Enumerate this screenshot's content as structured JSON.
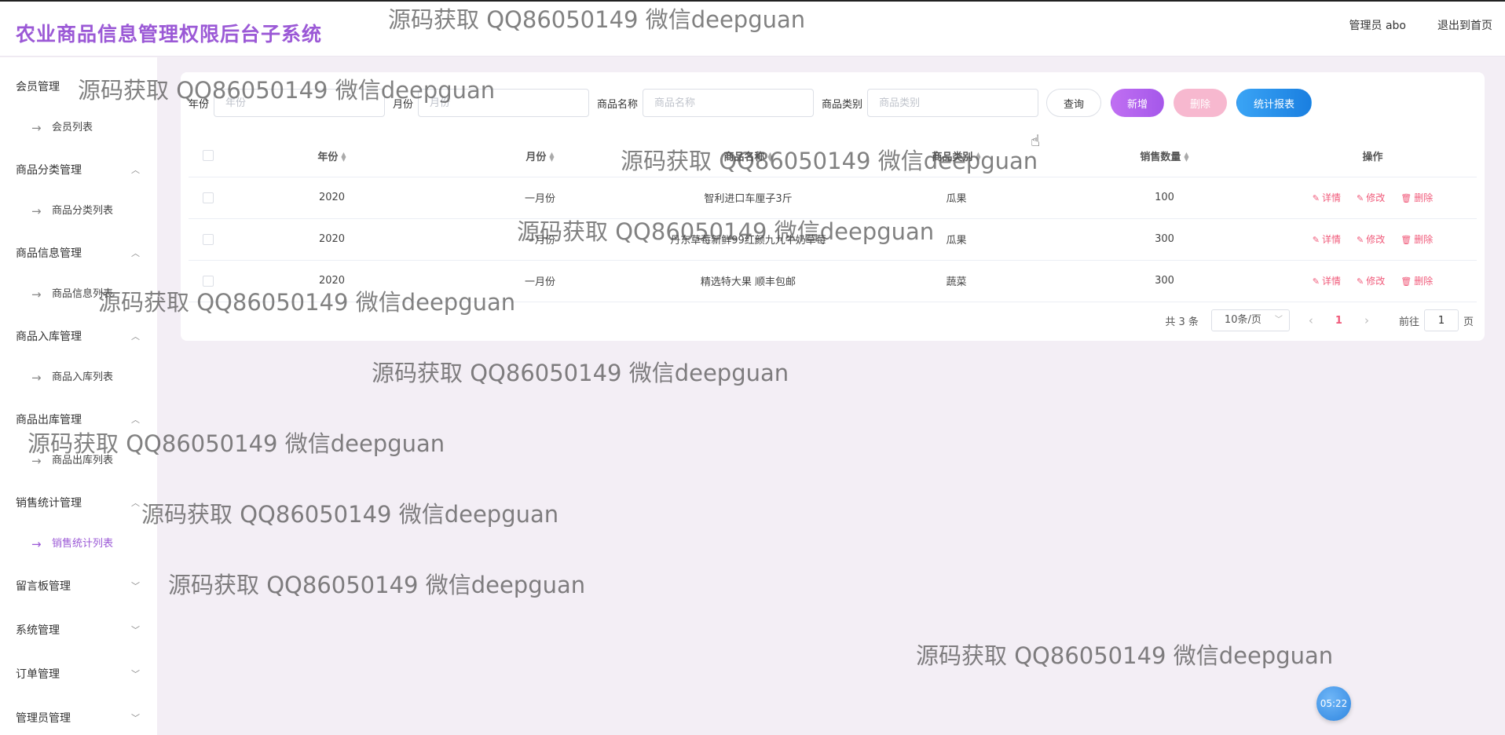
{
  "header": {
    "title": "农业商品信息管理权限后台子系统",
    "user": "管理员 abo",
    "exit": "退出到首页"
  },
  "sidebar": {
    "groups": [
      {
        "label": "会员管理",
        "chevron": "",
        "sub": "会员列表"
      },
      {
        "label": "商品分类管理",
        "chevron": "^",
        "sub": "商品分类列表"
      },
      {
        "label": "商品信息管理",
        "chevron": "^",
        "sub": "商品信息列表"
      },
      {
        "label": "商品入库管理",
        "chevron": "^",
        "sub": "商品入库列表"
      },
      {
        "label": "商品出库管理",
        "chevron": "^",
        "sub": "商品出库列表"
      },
      {
        "label": "销售统计管理",
        "chevron": "^",
        "sub": "销售统计列表"
      },
      {
        "label": "留言板管理",
        "chevron": "v"
      },
      {
        "label": "系统管理",
        "chevron": "v"
      },
      {
        "label": "订单管理",
        "chevron": "v"
      },
      {
        "label": "管理员管理",
        "chevron": "v"
      }
    ],
    "active_sub": "销售统计列表"
  },
  "search": {
    "year_label": "年份",
    "year_placeholder": "年份",
    "month_label": "月份",
    "month_placeholder": "月份",
    "name_label": "商品名称",
    "name_placeholder": "商品名称",
    "category_label": "商品类别",
    "category_placeholder": "商品类别",
    "query_btn": "查询",
    "add_btn": "新增",
    "delete_btn": "删除",
    "report_btn": "统计报表"
  },
  "table": {
    "headers": [
      "年份",
      "月份",
      "商品名称",
      "商品类别",
      "销售数量",
      "操作"
    ],
    "rows": [
      [
        "2020",
        "一月份",
        "智利进口车厘子3斤",
        "瓜果",
        "100"
      ],
      [
        "2020",
        "一月份",
        "丹东草莓新鲜99红颜九九牛奶草莓",
        "瓜果",
        "300"
      ],
      [
        "2020",
        "一月份",
        "精选特大果 顺丰包邮",
        "蔬菜",
        "300"
      ]
    ],
    "actions": {
      "detail": "详情",
      "edit": "修改",
      "delete": "删除"
    }
  },
  "pager": {
    "total": "共 3 条",
    "page_size": "10条/页",
    "current": "1",
    "goto_prefix": "前往",
    "goto_value": "1",
    "goto_suffix": "页"
  },
  "watermark": "源码获取 QQ86050149 微信deepguan",
  "clock": "05:22",
  "colors": {
    "brand": "#9b59d6",
    "danger": "#f05a7a",
    "report": "#1a7fe0"
  }
}
